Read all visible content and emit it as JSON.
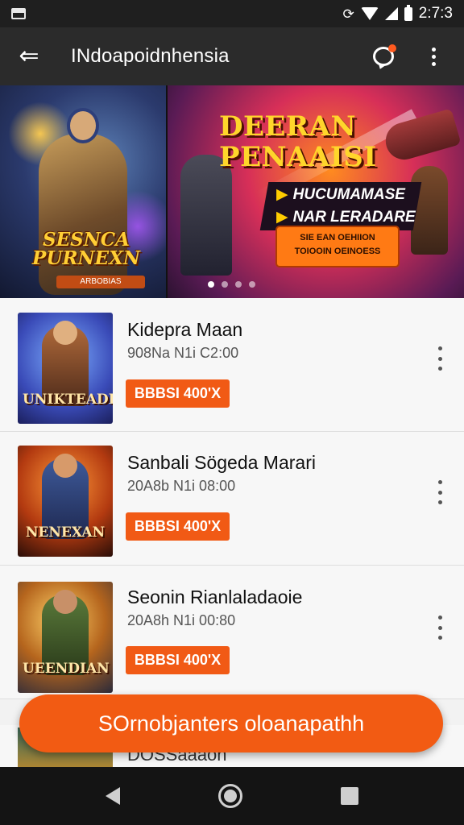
{
  "status_bar": {
    "time": "2:7:3",
    "icons": [
      "gallery-icon",
      "sync-icon",
      "wifi-icon",
      "signal-icon",
      "battery-icon"
    ]
  },
  "app_bar": {
    "title": "INdoapoidnhensia",
    "icons": [
      "back-arrow-icon",
      "notification-icon",
      "overflow-menu-icon"
    ],
    "has_notification": true
  },
  "banner": {
    "left": {
      "title": "SESNCA PURNEXN",
      "subtitle": "ARBOBIAS"
    },
    "right": {
      "headline": "DEERAN PENAAISI",
      "line1": "HUCUMAMASE",
      "line2": "NAR LERADARE",
      "promo_line1": "SIE EAN OEHIION",
      "promo_line2": "TOIOOIN OEINOESS"
    },
    "pages": 4,
    "active_page": 1
  },
  "games": [
    {
      "title": "Kidepra Maan",
      "meta": "908Na N1i C2:00",
      "button": "BBBSI 400'X",
      "thumb_label": "UNIKTEADH"
    },
    {
      "title": "Sanbali Sögeda Marari",
      "meta": "20A8b N1i 08:00",
      "button": "BBBSI 400'X",
      "thumb_label": "NENEXAN"
    },
    {
      "title": "Seonin Rianlaladaoie",
      "meta": "20A8h N1i 00:80",
      "button": "BBBSI 400'X",
      "thumb_label": "UEENDIAN"
    }
  ],
  "partial_row": {
    "text": "DOSSaaaon"
  },
  "fab": {
    "label": "SOrnobjanters oloanapathh"
  },
  "nav": {
    "icons": [
      "nav-back-icon",
      "nav-home-icon",
      "nav-recents-icon"
    ]
  },
  "colors": {
    "accent": "#f15a15",
    "app_bar": "#2b2b2b",
    "status_bar": "#1f1f1f"
  }
}
